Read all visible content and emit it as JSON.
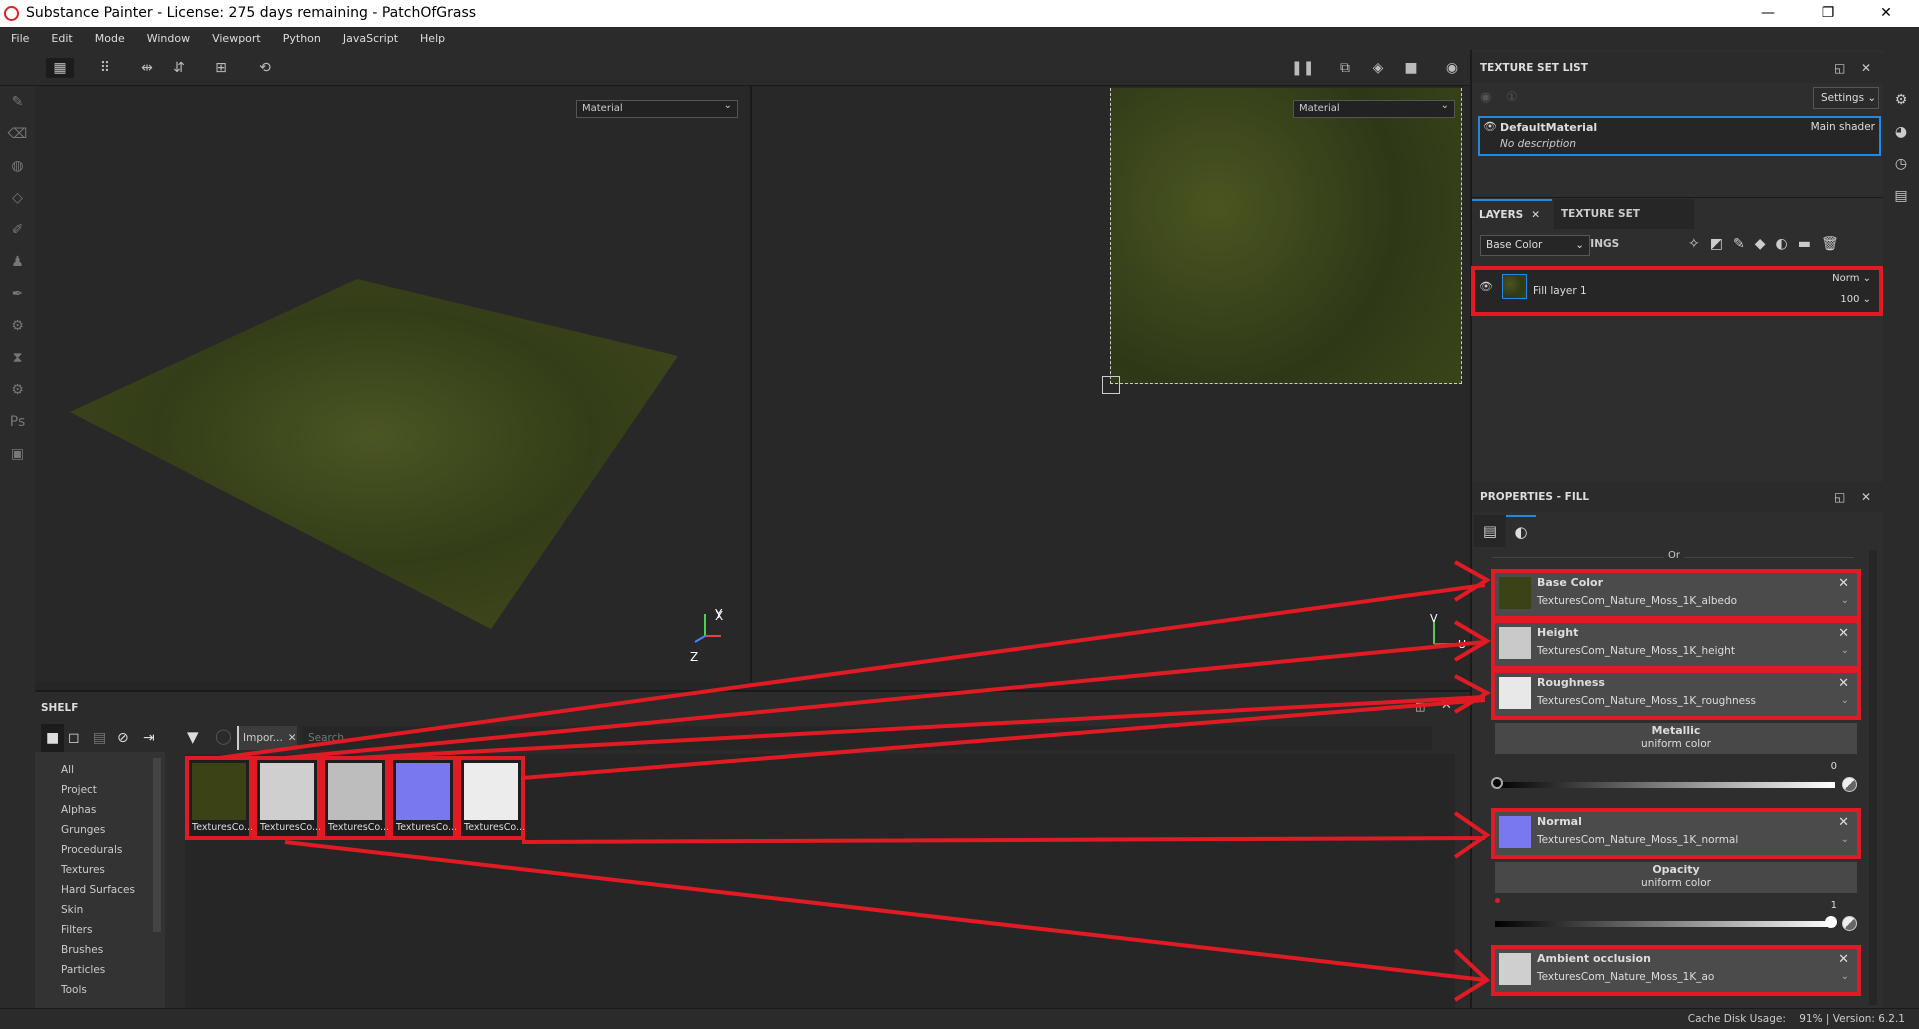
{
  "window": {
    "title": "Substance Painter - License: 275 days remaining - PatchOfGrass",
    "minimize": "—",
    "maximize": "❐",
    "close": "✕"
  },
  "menu": [
    "File",
    "Edit",
    "Mode",
    "Window",
    "Viewport",
    "Python",
    "JavaScript",
    "Help"
  ],
  "viewport3d": {
    "channel": "Material",
    "axis_x": "X",
    "axis_y": "Y",
    "axis_z": "Z"
  },
  "viewport2d": {
    "channel": "Material",
    "axis_y": "V",
    "axis_x": "U"
  },
  "texture_set_list": {
    "title": "TEXTURE SET LIST",
    "settings": "Settings",
    "material_name": "DefaultMaterial",
    "shader": "Main shader",
    "description": "No description"
  },
  "layers": {
    "tab_layers": "LAYERS",
    "tab_tss": "TEXTURE SET SETTINGS",
    "channel": "Base Color",
    "layer_name": "Fill layer 1",
    "blend_mode": "Norm",
    "opacity": "100"
  },
  "properties": {
    "title": "PROPERTIES - FILL",
    "or_label": "Or",
    "channels": [
      {
        "name": "Base Color",
        "texture": "TexturesCom_Nature_Moss_1K_albedo",
        "color": "#3b4216"
      },
      {
        "name": "Height",
        "texture": "TexturesCom_Nature_Moss_1K_height",
        "color": "#c9c9c9"
      },
      {
        "name": "Roughness",
        "texture": "TexturesCom_Nature_Moss_1K_roughness",
        "color": "#e8e8e8"
      },
      {
        "name": "Normal",
        "texture": "TexturesCom_Nature_Moss_1K_normal",
        "color": "#7a78ee"
      },
      {
        "name": "Ambient occlusion",
        "texture": "TexturesCom_Nature_Moss_1K_ao",
        "color": "#cfcfcf"
      }
    ],
    "metallic": {
      "name": "Metallic",
      "mode": "uniform color",
      "value": "0"
    },
    "opacity": {
      "name": "Opacity",
      "mode": "uniform color",
      "value": "1"
    }
  },
  "shelf": {
    "title": "SHELF",
    "filter_tab": "Impor...",
    "search_placeholder": "Search...",
    "categories": [
      "All",
      "Project",
      "Alphas",
      "Grunges",
      "Procedurals",
      "Textures",
      "Hard Surfaces",
      "Skin",
      "Filters",
      "Brushes",
      "Particles",
      "Tools"
    ],
    "thumbnails": [
      {
        "label": "TexturesCo...",
        "color": "#3b4216"
      },
      {
        "label": "TexturesCo...",
        "color": "#cfcfcf"
      },
      {
        "label": "TexturesCo...",
        "color": "#bdbdbd"
      },
      {
        "label": "TexturesCo...",
        "color": "#7a78ee"
      },
      {
        "label": "TexturesCo...",
        "color": "#ececec"
      }
    ]
  },
  "status": {
    "cache": "Cache Disk Usage:    91% | Version: 6.2.1"
  },
  "annotation_color": "#e01b24"
}
